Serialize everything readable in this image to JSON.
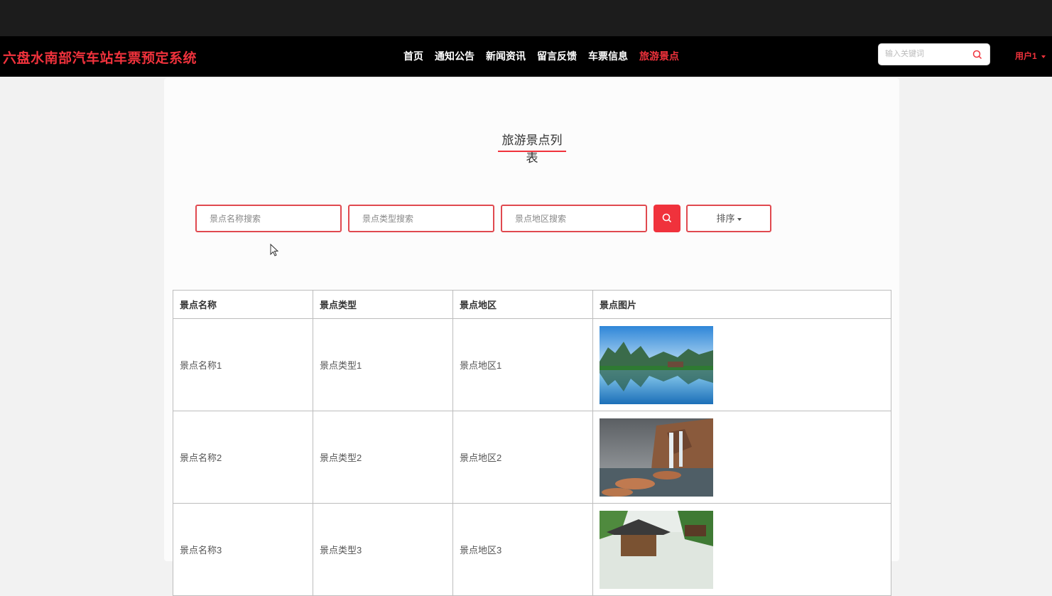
{
  "header": {
    "brand": "六盘水南部汽车站车票预定系统",
    "nav": [
      {
        "label": "首页",
        "active": false
      },
      {
        "label": "通知公告",
        "active": false
      },
      {
        "label": "新闻资讯",
        "active": false
      },
      {
        "label": "留言反馈",
        "active": false
      },
      {
        "label": "车票信息",
        "active": false
      },
      {
        "label": "旅游景点",
        "active": true
      }
    ],
    "search_placeholder": "输入关键词",
    "user_label": "用户1",
    "accent_color": "#f0323c"
  },
  "main": {
    "title": "旅游景点列表",
    "filters": {
      "name_placeholder": "景点名称搜索",
      "type_placeholder": "景点类型搜索",
      "area_placeholder": "景点地区搜索",
      "sort_label": "排序"
    },
    "table": {
      "headers": [
        "景点名称",
        "景点类型",
        "景点地区",
        "景点图片"
      ],
      "rows": [
        {
          "name": "景点名称1",
          "type": "景点类型1",
          "area": "景点地区1",
          "image": "lake-mountain-photo"
        },
        {
          "name": "景点名称2",
          "type": "景点类型2",
          "area": "景点地区2",
          "image": "waterfall-photo"
        },
        {
          "name": "景点名称3",
          "type": "景点类型3",
          "area": "景点地区3",
          "image": "pavilion-photo"
        }
      ]
    }
  }
}
